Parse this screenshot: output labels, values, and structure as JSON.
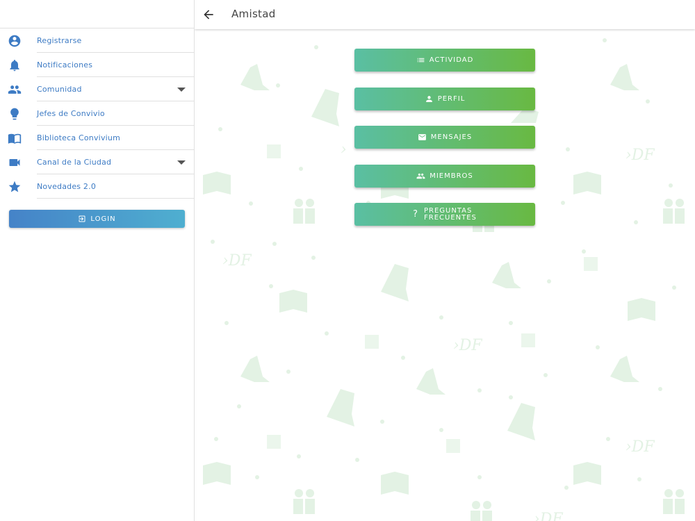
{
  "sidebar": {
    "items": [
      {
        "label": "Registrarse",
        "icon": "account-circle-icon",
        "expandable": false
      },
      {
        "label": "Notificaciones",
        "icon": "bell-icon",
        "expandable": false
      },
      {
        "label": "Comunidad",
        "icon": "people-icon",
        "expandable": true
      },
      {
        "label": "Jefes de Convivio",
        "icon": "lightbulb-icon",
        "expandable": false
      },
      {
        "label": "Biblioteca Convivium",
        "icon": "book-icon",
        "expandable": false
      },
      {
        "label": "Canal de la Ciudad",
        "icon": "video-camera-icon",
        "expandable": true
      },
      {
        "label": "Novedades 2.0",
        "icon": "star-icon",
        "expandable": false
      }
    ],
    "login_label": "LOGIN"
  },
  "header": {
    "title": "Amistad",
    "back_icon": "arrow-back-icon"
  },
  "actions": [
    {
      "label": "ACTIVIDAD",
      "icon": "list-icon"
    },
    {
      "label": "PERFIL",
      "icon": "person-icon"
    },
    {
      "label": "MENSAJES",
      "icon": "mail-icon"
    },
    {
      "label": "MIEMBROS",
      "icon": "people-icon"
    },
    {
      "label_line1": "PREGUNTAS",
      "label_line2": "FRECUENTES",
      "icon": "question-icon",
      "glyph": "?"
    }
  ],
  "colors": {
    "primary_blue": "#3d7bc4",
    "button_gradient_start": "#5abfa3",
    "button_gradient_end": "#69b942",
    "login_gradient_start": "#4583c8",
    "login_gradient_end": "#4fafd0",
    "pattern_color": "#e3f2e4"
  }
}
